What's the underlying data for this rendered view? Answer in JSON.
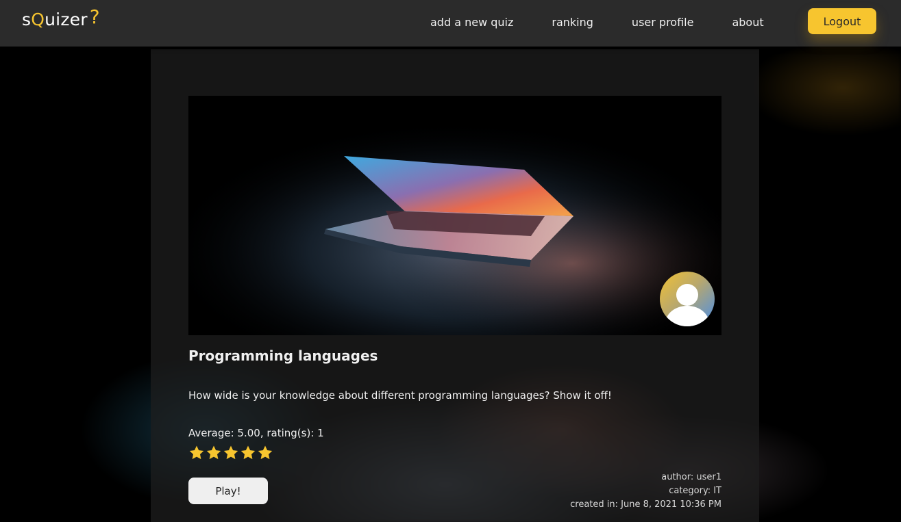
{
  "brand": {
    "logo_prefix": "s",
    "logo_q": "Q",
    "logo_suffix": "uizer",
    "logo_mark": "?",
    "accent_color": "#f7c52f"
  },
  "nav": {
    "links": [
      {
        "label": "add a new quiz"
      },
      {
        "label": "ranking"
      },
      {
        "label": "user profile"
      },
      {
        "label": "about"
      }
    ],
    "logout_label": "Logout"
  },
  "quiz": {
    "title": "Programming languages",
    "description": "How wide is your knowledge about different programming languages? Show it off!",
    "rating_summary": "Average: 5.00, rating(s): 1",
    "stars_filled": 5,
    "stars_total": 5,
    "play_label": "Play!",
    "author": "author: user1",
    "category": "category: IT",
    "created": "created in: June 8, 2021 10:36 PM",
    "hero_image": "laptop-photo",
    "author_avatar": "user-avatar-icon"
  }
}
